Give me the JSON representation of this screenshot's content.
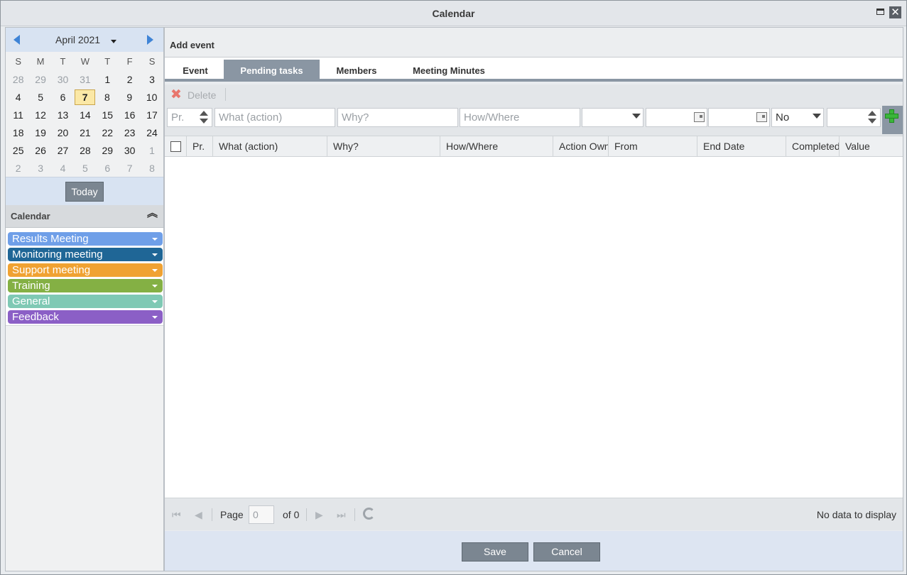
{
  "window": {
    "title": "Calendar"
  },
  "calendar": {
    "month_label": "April 2021",
    "dow": [
      "S",
      "M",
      "T",
      "W",
      "T",
      "F",
      "S"
    ],
    "weeks": [
      [
        "28",
        "29",
        "30",
        "31",
        "1",
        "2",
        "3"
      ],
      [
        "4",
        "5",
        "6",
        "7",
        "8",
        "9",
        "10"
      ],
      [
        "11",
        "12",
        "13",
        "14",
        "15",
        "16",
        "17"
      ],
      [
        "18",
        "19",
        "20",
        "21",
        "22",
        "23",
        "24"
      ],
      [
        "25",
        "26",
        "27",
        "28",
        "29",
        "30",
        "1"
      ],
      [
        "2",
        "3",
        "4",
        "5",
        "6",
        "7",
        "8"
      ]
    ],
    "today_button": "Today"
  },
  "calendars_section": {
    "title": "Calendar",
    "items": [
      {
        "label": "Results Meeting",
        "color": "#6f9fe8"
      },
      {
        "label": "Monitoring meeting",
        "color": "#1f6696"
      },
      {
        "label": "Support meeting",
        "color": "#f0a232"
      },
      {
        "label": "Training",
        "color": "#84b044"
      },
      {
        "label": "General",
        "color": "#7fc9b4"
      },
      {
        "label": "Feedback",
        "color": "#8b5fc6"
      }
    ]
  },
  "panel": {
    "title": "Add event"
  },
  "tabs": [
    "Event",
    "Pending tasks",
    "Members",
    "Meeting Minutes"
  ],
  "toolbar": {
    "delete": "Delete"
  },
  "filter": {
    "pr": "Pr.",
    "what": "What (action)",
    "why": "Why?",
    "how": "How/Where",
    "completed_value": "No"
  },
  "columns": [
    "Pr.",
    "What (action)",
    "Why?",
    "How/Where",
    "Action Owner",
    "From",
    "End Date",
    "Completed",
    "Value"
  ],
  "pager": {
    "page_label": "Page",
    "page_value": "0",
    "of_label": "of 0",
    "status": "No data to display"
  },
  "footer": {
    "save": "Save",
    "cancel": "Cancel"
  }
}
